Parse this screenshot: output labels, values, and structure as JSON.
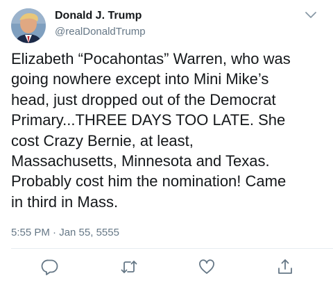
{
  "author": {
    "display_name": "Donald J. Trump",
    "handle": "@realDonaldTrump",
    "avatar_icon": "profile-photo"
  },
  "tweet": {
    "lines": [
      "Elizabeth “Pocahontas” Warren, who was",
      "going nowhere except into Mini Mike’s",
      "head, just dropped out of the Democrat",
      "Primary...THREE DAYS TOO LATE. She",
      "cost Crazy Bernie, at least,",
      "Massachusetts, Minnesota and Texas.",
      "Probably cost him the nomination! Came",
      "in third in Mass."
    ],
    "timestamp": "5:55 PM · Jan 55, 5555"
  },
  "actions": {
    "reply_icon": "reply-icon",
    "retweet_icon": "retweet-icon",
    "like_icon": "like-icon",
    "share_icon": "share-icon"
  },
  "colors": {
    "text_primary": "#14171a",
    "text_secondary": "#657786",
    "icon": "#657786",
    "divider": "#e6ecf0"
  }
}
